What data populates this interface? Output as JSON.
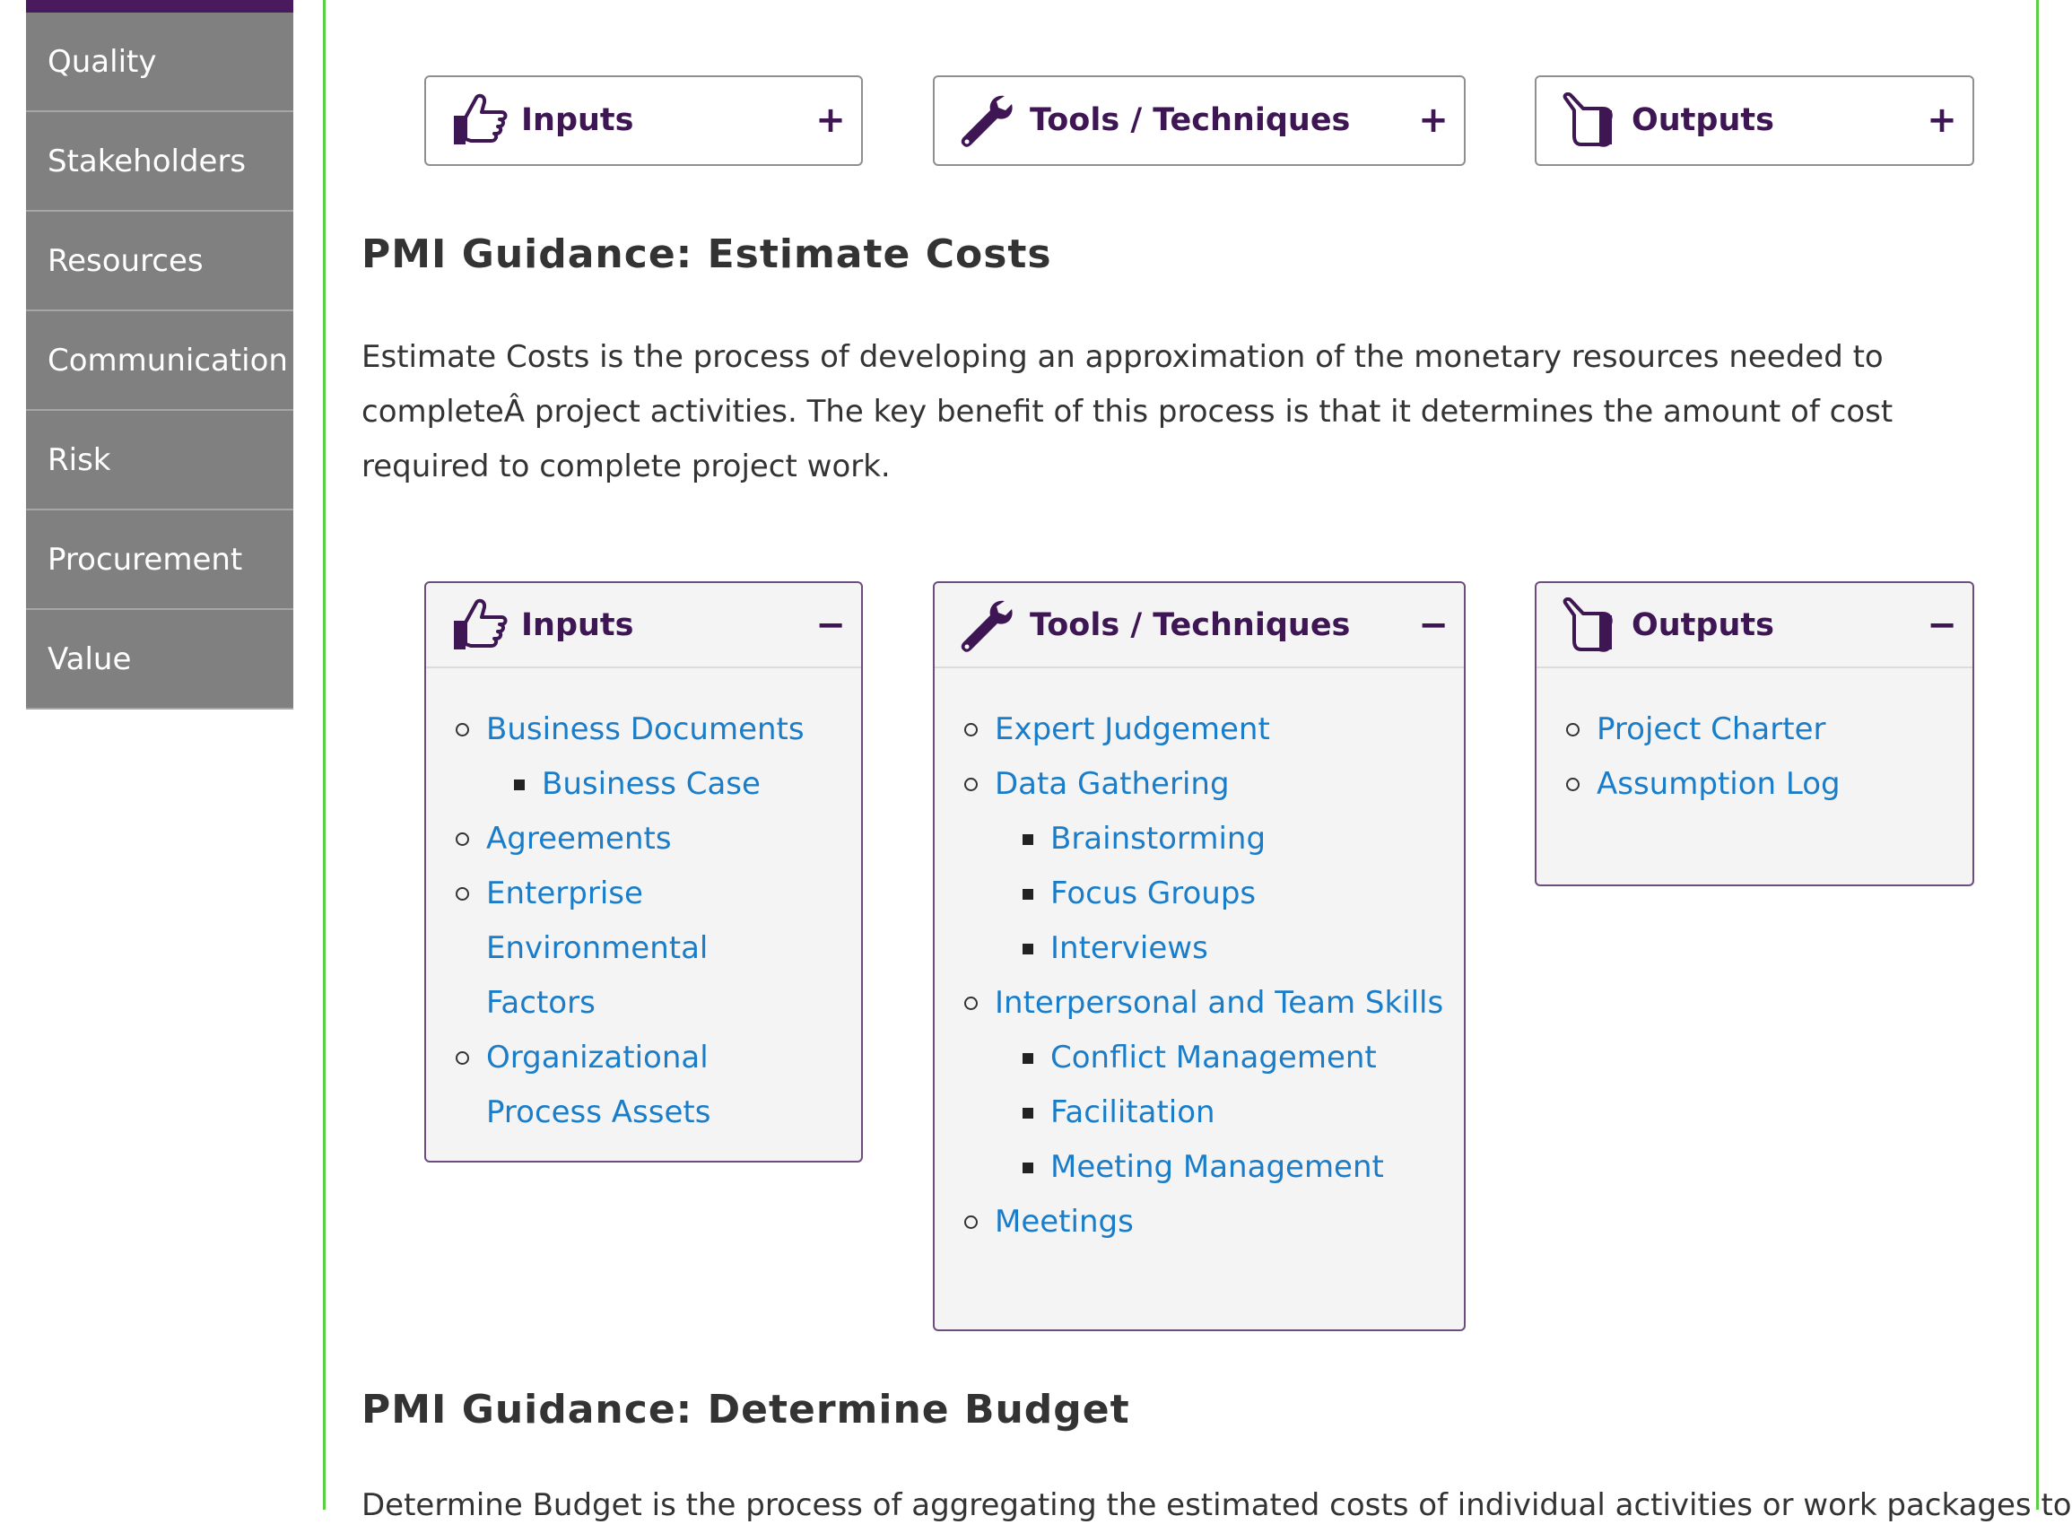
{
  "sidebar": {
    "items": [
      {
        "label": "Quality"
      },
      {
        "label": "Stakeholders"
      },
      {
        "label": "Resources"
      },
      {
        "label": "Communication"
      },
      {
        "label": "Risk"
      },
      {
        "label": "Procurement"
      },
      {
        "label": "Value"
      }
    ]
  },
  "top_accordions": {
    "inputs": {
      "title": "Inputs",
      "toggle": "+"
    },
    "tools": {
      "title": "Tools / Techniques",
      "toggle": "+"
    },
    "outputs": {
      "title": "Outputs",
      "toggle": "+"
    }
  },
  "estimate_costs": {
    "heading": "PMI Guidance: Estimate Costs",
    "description": "Estimate Costs is the process of developing an approximation of the monetary resources needed to completeÂ project activities. The key benefit of this process is that it determines the amount of cost required to complete project work.",
    "inputs": {
      "title": "Inputs",
      "toggle": "−",
      "items": [
        {
          "label": "Business Documents",
          "children": [
            "Business Case"
          ]
        },
        {
          "label": "Agreements"
        },
        {
          "label": "Enterprise Environmental Factors"
        },
        {
          "label": "Organizational Process Assets"
        }
      ]
    },
    "tools": {
      "title": "Tools / Techniques",
      "toggle": "−",
      "items": [
        {
          "label": "Expert Judgement"
        },
        {
          "label": "Data Gathering",
          "children": [
            "Brainstorming",
            "Focus Groups",
            "Interviews"
          ]
        },
        {
          "label": "Interpersonal and Team Skills",
          "children": [
            "Conflict Management",
            "Facilitation",
            "Meeting Management"
          ]
        },
        {
          "label": "Meetings"
        }
      ]
    },
    "outputs": {
      "title": "Outputs",
      "toggle": "−",
      "items": [
        {
          "label": "Project Charter"
        },
        {
          "label": "Assumption Log"
        }
      ]
    }
  },
  "determine_budget": {
    "heading": "PMI Guidance: Determine Budget",
    "description": "Determine Budget is the process of aggregating the estimated costs of individual activities or work packages toÂ"
  },
  "colors": {
    "sidebar_bg": "#808080",
    "sidebar_top": "#4a1a5e",
    "frame_border": "#5cd043",
    "accordion_title": "#3f1654",
    "link": "#1a7dc9"
  }
}
